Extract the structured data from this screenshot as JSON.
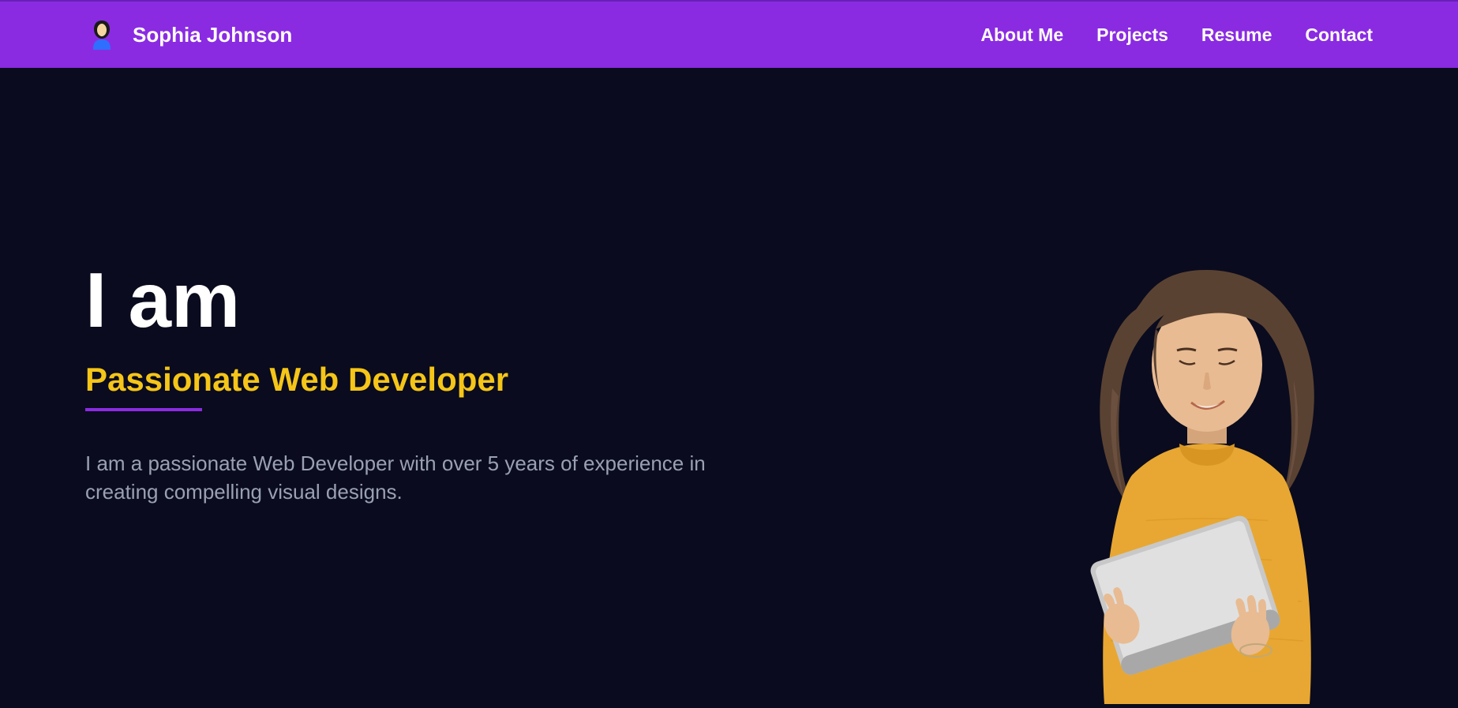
{
  "header": {
    "brand_name": "Sophia Johnson",
    "nav": [
      {
        "label": "About Me"
      },
      {
        "label": "Projects"
      },
      {
        "label": "Resume"
      },
      {
        "label": "Contact"
      }
    ]
  },
  "hero": {
    "heading": "I am",
    "subheading": "Passionate Web Developer",
    "description": "I am a passionate Web Developer with over 5 years of experience in creating compelling visual designs."
  },
  "colors": {
    "accent": "#8a2be2",
    "highlight": "#f5c518",
    "background": "#0a0b1e"
  }
}
